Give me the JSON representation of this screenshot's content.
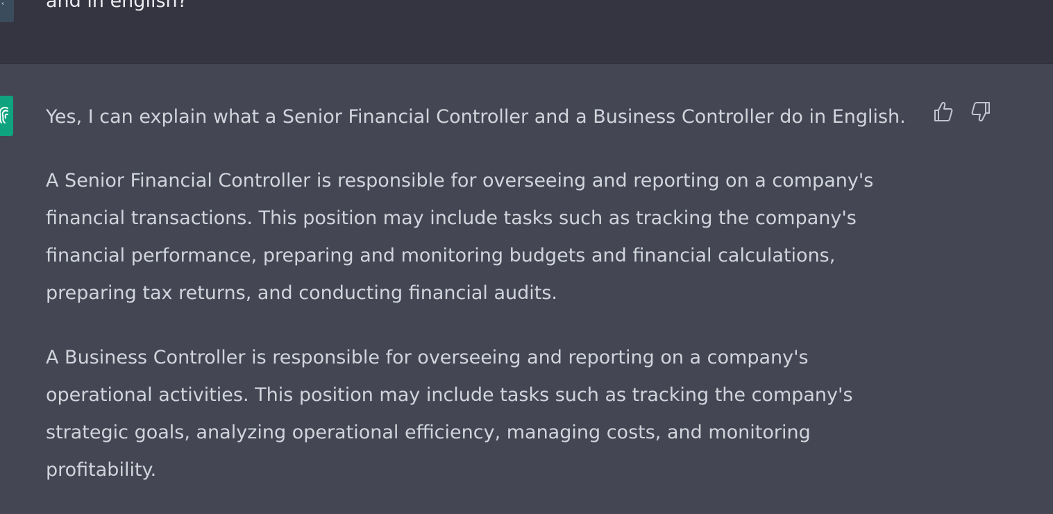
{
  "user_message": {
    "text": "and in english?"
  },
  "assistant_message": {
    "paragraphs": [
      "Yes, I can explain what a Senior Financial Controller and a Business Controller do in English.",
      "A Senior Financial Controller is responsible for overseeing and reporting on a company's financial transactions. This position may include tasks such as tracking the company's financial performance, preparing and monitoring budgets and financial calculations, preparing tax returns, and conducting financial audits.",
      "A Business Controller is responsible for overseeing and reporting on a company's operational activities. This position may include tasks such as tracking the company's strategic goals, analyzing operational efficiency, managing costs, and monitoring profitability."
    ]
  },
  "icons": {
    "user_avatar": "user-avatar-icon",
    "assistant_avatar": "chatgpt-logo-icon",
    "thumbs_up": "thumbs-up-icon",
    "thumbs_down": "thumbs-down-icon"
  },
  "colors": {
    "user_bg": "#343541",
    "assistant_bg": "#444654",
    "assistant_avatar": "#10a37f",
    "text": "#d1d5db"
  }
}
